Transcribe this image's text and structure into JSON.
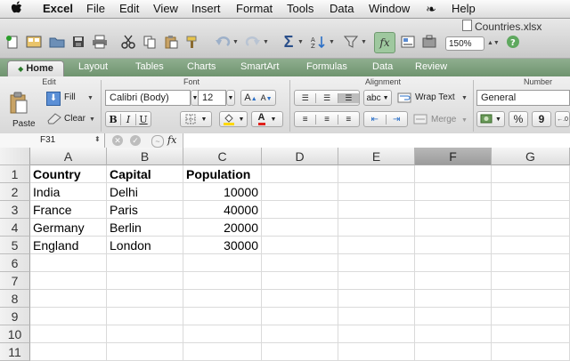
{
  "menubar": {
    "apple": "",
    "app": "Excel",
    "items": [
      "File",
      "Edit",
      "View",
      "Insert",
      "Format",
      "Tools",
      "Data",
      "Window",
      "Help"
    ]
  },
  "toolbar": {
    "document_title": "Countries.xlsx",
    "zoom": "150%"
  },
  "ribbon": {
    "tabs": [
      "Home",
      "Layout",
      "Tables",
      "Charts",
      "SmartArt",
      "Formulas",
      "Data",
      "Review"
    ],
    "active_tab": "Home",
    "groups": {
      "edit": "Edit",
      "font": "Font",
      "alignment": "Alignment",
      "number": "Number"
    },
    "edit": {
      "paste": "Paste",
      "fill": "Fill",
      "clear": "Clear"
    },
    "font": {
      "name": "Calibri (Body)",
      "size": "12",
      "bold": "B",
      "italic": "I",
      "underline": "U",
      "grow": "A",
      "shrink": "A",
      "color_letter": "A"
    },
    "alignment": {
      "wrap_text": "Wrap Text",
      "merge": "Merge",
      "abc": "abc"
    },
    "number": {
      "format": "General",
      "percent": "%",
      "comma": "9"
    }
  },
  "formula_bar": {
    "name_box": "F31",
    "fx": "fx",
    "formula": ""
  },
  "sheet": {
    "columns": [
      "A",
      "B",
      "C",
      "D",
      "E",
      "F",
      "G"
    ],
    "selected_column": "F",
    "rows": [
      "1",
      "2",
      "3",
      "4",
      "5",
      "6",
      "7",
      "8",
      "9",
      "10",
      "11"
    ],
    "cells": [
      [
        "Country",
        "Capital",
        "Population",
        "",
        "",
        "",
        ""
      ],
      [
        "India",
        "Delhi",
        "10000",
        "",
        "",
        "",
        ""
      ],
      [
        "France",
        "Paris",
        "40000",
        "",
        "",
        "",
        ""
      ],
      [
        "Germany",
        "Berlin",
        "20000",
        "",
        "",
        "",
        ""
      ],
      [
        "England",
        "London",
        "30000",
        "",
        "",
        "",
        ""
      ]
    ]
  },
  "colors": {
    "tab_bar": "#7a9e7a",
    "selected_header": "#a8a8a8",
    "font_color_swatch": "#e0201a",
    "fill_color_swatch": "#ffd800"
  }
}
